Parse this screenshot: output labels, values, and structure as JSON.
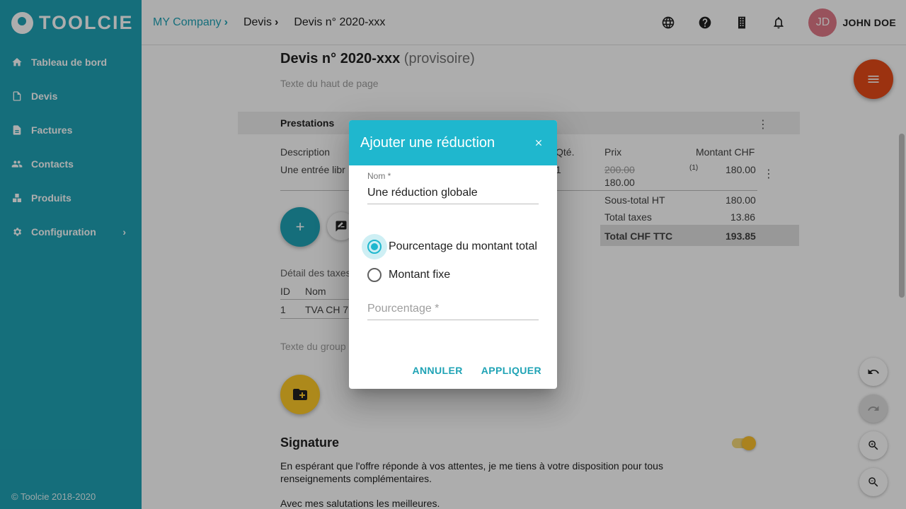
{
  "app": {
    "logo_text": "TOOLCIE",
    "copyright": "© Toolcie 2018-2020"
  },
  "sidebar": {
    "items": [
      {
        "label": "Tableau de bord",
        "icon": "home-icon"
      },
      {
        "label": "Devis",
        "icon": "quote-icon"
      },
      {
        "label": "Factures",
        "icon": "invoice-icon"
      },
      {
        "label": "Contacts",
        "icon": "people-icon"
      },
      {
        "label": "Produits",
        "icon": "products-icon"
      },
      {
        "label": "Configuration",
        "icon": "gear-icon"
      }
    ]
  },
  "header": {
    "breadcrumbs": [
      "MY Company",
      "Devis",
      "Devis n° 2020-xxx"
    ],
    "user": {
      "initials": "JD",
      "name": "JOHN DOE"
    }
  },
  "document": {
    "title": "Devis n° 2020-xxx",
    "status": "(provisoire)",
    "header_hint": "Texte du haut de page",
    "section_label": "Prestations",
    "columns": {
      "description": "Description",
      "qty": "Qté.",
      "price": "Prix",
      "amount": "Montant CHF"
    },
    "row": {
      "description": "Une entrée libr",
      "qty": "1",
      "old_price": "200.00",
      "price": "180.00",
      "note": "(1)",
      "amount": "180.00"
    },
    "totals": {
      "subtotal_label": "Sous-total HT",
      "subtotal": "180.00",
      "taxes_label": "Total taxes",
      "taxes": "13.86",
      "total_label": "Total CHF TTC",
      "total": "193.85"
    },
    "fab_add": "+",
    "tax_detail": {
      "title": "Détail des taxes",
      "col_id": "ID",
      "col_name": "Nom",
      "row_id": "1",
      "row_name": "TVA CH 7."
    },
    "group_hint": "Texte du group",
    "signature": {
      "title": "Signature",
      "text": "En espérant que l'offre réponde à vos attentes, je me tiens à votre disposition pour tous renseignements complémentaires.",
      "closing": "Avec mes salutations les meilleures."
    }
  },
  "dialog": {
    "title": "Ajouter une réduction",
    "name_label": "Nom *",
    "name_value": "Une réduction globale",
    "options": [
      {
        "label": "Pourcentage du montant total",
        "checked": true
      },
      {
        "label": "Montant fixe",
        "checked": false
      }
    ],
    "percentage_placeholder": "Pourcentage *",
    "cancel_label": "ANNULER",
    "apply_label": "APPLIQUER"
  },
  "colors": {
    "primary": "#1fa3b5",
    "dialog_header": "#1fb7ce",
    "menu_fab": "#e64a19",
    "accent_yellow": "#ffca28"
  }
}
